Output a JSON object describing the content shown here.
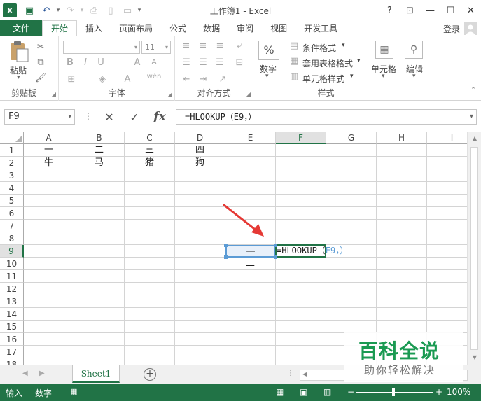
{
  "window": {
    "title": "工作簿1 - Excel",
    "app_icon": "X",
    "help": "?",
    "controls": [
      "ribbon-display-icon",
      "minimize-icon",
      "maximize-icon",
      "close-icon"
    ]
  },
  "tabs": [
    "文件",
    "开始",
    "插入",
    "页面布局",
    "公式",
    "数据",
    "审阅",
    "视图",
    "开发工具"
  ],
  "active_tab": "开始",
  "login": "登录",
  "ribbon": {
    "clipboard": {
      "paste": "粘贴",
      "label": "剪贴板"
    },
    "font": {
      "name": "",
      "size": "11",
      "label": "字体"
    },
    "alignment": {
      "label": "对齐方式"
    },
    "number": {
      "button": "数字",
      "symbol": "%"
    },
    "styles": {
      "conditional": "条件格式",
      "table": "套用表格格式",
      "cell": "单元格样式",
      "label": "样式"
    },
    "cells": {
      "button": "单元格"
    },
    "editing": {
      "button": "编辑"
    }
  },
  "formula_bar": {
    "name_box": "F9",
    "formula": "=HLOOKUP（E9，）"
  },
  "grid": {
    "columns": [
      "A",
      "B",
      "C",
      "D",
      "E",
      "F",
      "G",
      "H",
      "I"
    ],
    "rows": [
      "1",
      "2",
      "3",
      "4",
      "5",
      "6",
      "7",
      "8",
      "9",
      "10",
      "11",
      "12",
      "13",
      "14",
      "15",
      "16",
      "17",
      "18"
    ],
    "selected_column": "F",
    "selected_row": "9",
    "cells": {
      "A1": "一",
      "B1": "二",
      "C1": "三",
      "D1": "四",
      "A2": "牛",
      "B2": "马",
      "C2": "猪",
      "D2": "狗",
      "E9": "一",
      "E10": "二",
      "F9_prefix": "=HLOOKUP（",
      "F9_ref": "E9，）"
    }
  },
  "sheets": {
    "active": "Sheet1"
  },
  "status": {
    "mode": "输入",
    "numlock": "数字",
    "zoom": "100%"
  },
  "watermark": {
    "line1": "百科全说",
    "line2": "助你轻松解决"
  },
  "colors": {
    "excel_green": "#217346",
    "selection_blue": "#5b9bd5",
    "arrow_red": "#e53935"
  }
}
